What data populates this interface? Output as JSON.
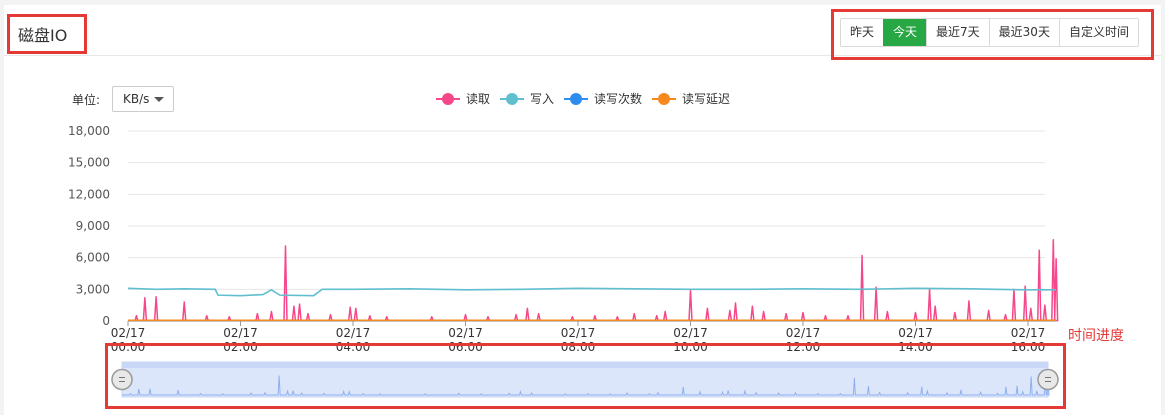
{
  "panel": {
    "title": "磁盘IO"
  },
  "range_buttons": [
    {
      "label": "昨天",
      "active": false
    },
    {
      "label": "今天",
      "active": true
    },
    {
      "label": "最近7天",
      "active": false
    },
    {
      "label": "最近30天",
      "active": false
    },
    {
      "label": "自定义时间",
      "active": false
    }
  ],
  "unit": {
    "label": "单位:",
    "selected": "KB/s"
  },
  "annotation": "时间进度",
  "colors": {
    "read": "#f5478a",
    "write": "#5fbfcf",
    "rw_count": "#2d8cf0",
    "rw_latency": "#f7891f",
    "accent": "#28a745"
  },
  "chart_data": {
    "type": "line",
    "y_ticks": [
      "18,000",
      "15,000",
      "12,000",
      "9,000",
      "6,000",
      "3,000",
      "0"
    ],
    "ylim": [
      0,
      18000
    ],
    "x_ticks": [
      {
        "date": "02/17",
        "time": "00:00"
      },
      {
        "date": "02/17",
        "time": "02:00"
      },
      {
        "date": "02/17",
        "time": "04:00"
      },
      {
        "date": "02/17",
        "time": "06:00"
      },
      {
        "date": "02/17",
        "time": "08:00"
      },
      {
        "date": "02/17",
        "time": "10:00"
      },
      {
        "date": "02/17",
        "time": "12:00"
      },
      {
        "date": "02/17",
        "time": "14:00"
      },
      {
        "date": "02/17",
        "time": "16:00"
      }
    ],
    "xlim_hours": [
      0,
      16.5
    ],
    "series": [
      {
        "name": "读取",
        "key": "read",
        "type": "spikes",
        "baseline": 30,
        "points": [
          [
            0.15,
            500
          ],
          [
            0.3,
            2200
          ],
          [
            0.5,
            2300
          ],
          [
            1.0,
            1800
          ],
          [
            1.4,
            500
          ],
          [
            1.8,
            400
          ],
          [
            2.3,
            700
          ],
          [
            2.55,
            900
          ],
          [
            2.8,
            7100
          ],
          [
            2.95,
            1400
          ],
          [
            3.05,
            1600
          ],
          [
            3.2,
            700
          ],
          [
            3.6,
            600
          ],
          [
            3.95,
            1300
          ],
          [
            4.05,
            1200
          ],
          [
            4.3,
            500
          ],
          [
            4.6,
            400
          ],
          [
            5.4,
            400
          ],
          [
            6.0,
            600
          ],
          [
            6.4,
            400
          ],
          [
            6.9,
            600
          ],
          [
            7.1,
            1200
          ],
          [
            7.3,
            700
          ],
          [
            7.9,
            400
          ],
          [
            8.3,
            500
          ],
          [
            8.7,
            400
          ],
          [
            9.0,
            700
          ],
          [
            9.4,
            500
          ],
          [
            9.55,
            900
          ],
          [
            10.0,
            2900
          ],
          [
            10.3,
            1200
          ],
          [
            10.7,
            1000
          ],
          [
            10.8,
            1700
          ],
          [
            11.1,
            1400
          ],
          [
            11.3,
            900
          ],
          [
            11.7,
            700
          ],
          [
            12.0,
            800
          ],
          [
            12.4,
            500
          ],
          [
            12.8,
            500
          ],
          [
            13.05,
            6200
          ],
          [
            13.3,
            3200
          ],
          [
            13.5,
            900
          ],
          [
            14.0,
            800
          ],
          [
            14.25,
            3000
          ],
          [
            14.35,
            1400
          ],
          [
            14.7,
            800
          ],
          [
            14.95,
            1900
          ],
          [
            15.3,
            1000
          ],
          [
            15.6,
            600
          ],
          [
            15.75,
            3000
          ],
          [
            15.95,
            3300
          ],
          [
            16.05,
            1200
          ],
          [
            16.2,
            6700
          ],
          [
            16.3,
            1500
          ],
          [
            16.45,
            7700
          ],
          [
            16.5,
            5900
          ]
        ]
      },
      {
        "name": "写入",
        "key": "write",
        "type": "line",
        "points": [
          [
            0,
            3100
          ],
          [
            0.5,
            3000
          ],
          [
            1.0,
            3050
          ],
          [
            1.55,
            3000
          ],
          [
            1.6,
            2450
          ],
          [
            2.0,
            2400
          ],
          [
            2.4,
            2500
          ],
          [
            2.55,
            2950
          ],
          [
            2.7,
            2450
          ],
          [
            3.3,
            2400
          ],
          [
            3.45,
            3000
          ],
          [
            4.0,
            3000
          ],
          [
            5.0,
            3050
          ],
          [
            6.0,
            2950
          ],
          [
            7.0,
            3000
          ],
          [
            8.0,
            3100
          ],
          [
            9.0,
            3050
          ],
          [
            10.0,
            3000
          ],
          [
            11.0,
            3000
          ],
          [
            12.0,
            3050
          ],
          [
            13.0,
            3000
          ],
          [
            14.0,
            3100
          ],
          [
            15.0,
            3050
          ],
          [
            15.4,
            3000
          ],
          [
            16.0,
            2950
          ],
          [
            16.5,
            2950
          ]
        ]
      },
      {
        "name": "读写次数",
        "key": "rw_count",
        "type": "line",
        "points": [
          [
            0,
            40
          ],
          [
            16.5,
            40
          ]
        ]
      },
      {
        "name": "读写延迟",
        "key": "rw_latency",
        "type": "line",
        "points": [
          [
            0,
            60
          ],
          [
            16.5,
            60
          ]
        ]
      }
    ]
  }
}
